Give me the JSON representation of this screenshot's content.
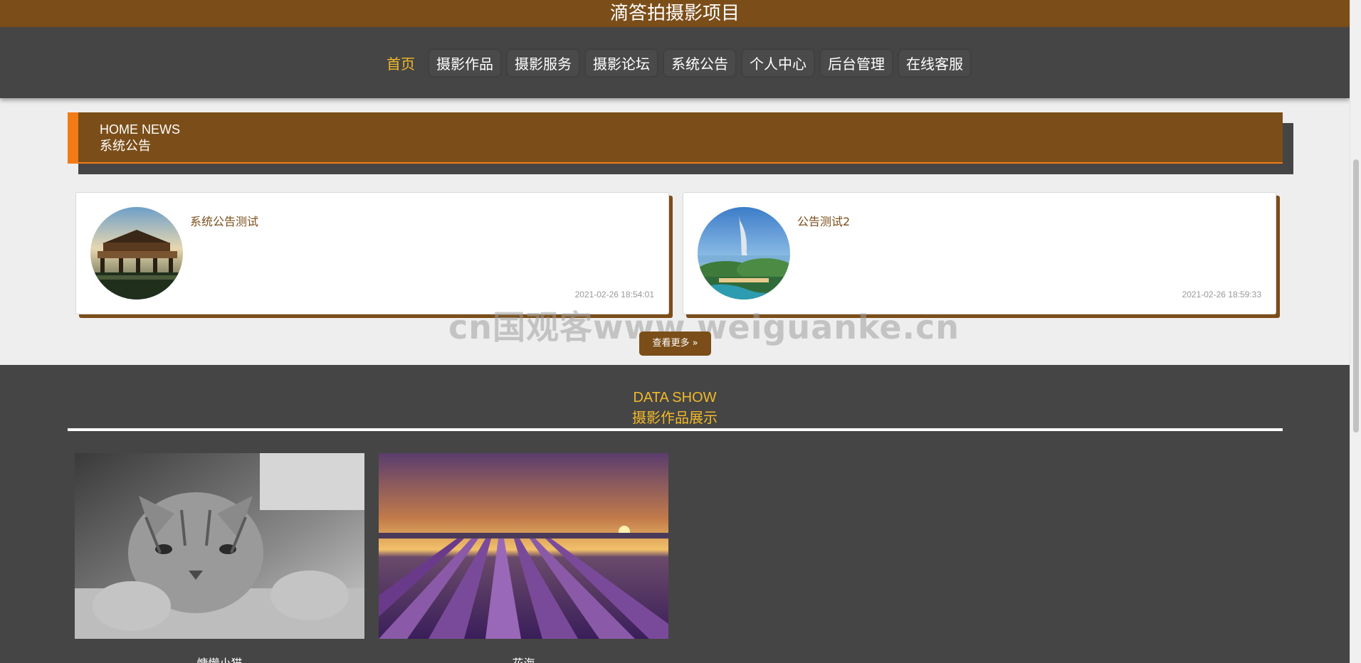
{
  "site": {
    "title": "滴答拍摄影项目"
  },
  "nav": {
    "items": [
      {
        "label": "首页",
        "active": true
      },
      {
        "label": "摄影作品"
      },
      {
        "label": "摄影服务"
      },
      {
        "label": "摄影论坛"
      },
      {
        "label": "系统公告"
      },
      {
        "label": "个人中心"
      },
      {
        "label": "后台管理"
      },
      {
        "label": "在线客服"
      }
    ]
  },
  "news": {
    "heading_en": "HOME NEWS",
    "heading_cn": "系统公告",
    "cards": [
      {
        "title": "系统公告测试",
        "time": "2021-02-26 18:54:01"
      },
      {
        "title": "公告测试2",
        "time": "2021-02-26 18:59:33"
      }
    ],
    "more_label": "查看更多"
  },
  "watermark": "cn国观客www.weiguanke.cn",
  "data_show": {
    "heading_en": "DATA SHOW",
    "heading_cn": "摄影作品展示",
    "items": [
      {
        "caption": "慵懒小猫"
      },
      {
        "caption": "花海"
      }
    ]
  },
  "colors": {
    "brand": "#7b4e19",
    "accent": "#f27b15",
    "nav_bg": "#454545",
    "active": "#f2b929"
  }
}
